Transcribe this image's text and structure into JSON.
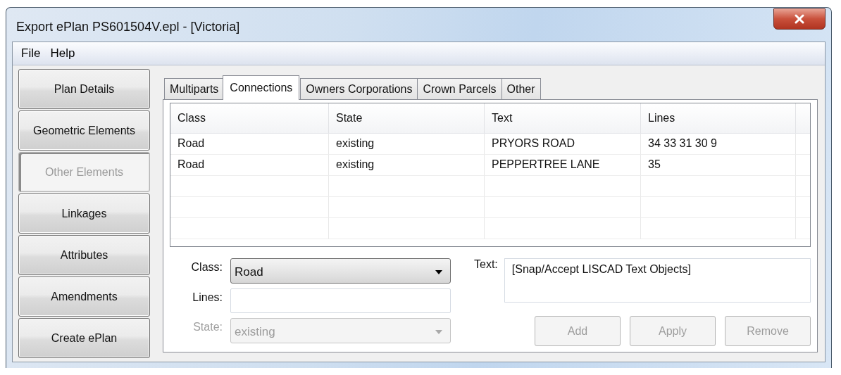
{
  "window": {
    "title": "Export ePlan PS601504V.epl - [Victoria]"
  },
  "menu": [
    {
      "label": "File"
    },
    {
      "label": "Help"
    }
  ],
  "sidebar": {
    "items": [
      {
        "label": "Plan Details",
        "selected": false
      },
      {
        "label": "Geometric Elements",
        "selected": false
      },
      {
        "label": "Other Elements",
        "selected": true
      },
      {
        "label": "Linkages",
        "selected": false
      },
      {
        "label": "Attributes",
        "selected": false
      },
      {
        "label": "Amendments",
        "selected": false
      },
      {
        "label": "Create ePlan",
        "selected": false
      }
    ]
  },
  "tabs": [
    {
      "label": "Multiparts",
      "selected": false
    },
    {
      "label": "Connections",
      "selected": true
    },
    {
      "label": "Owners Corporations",
      "selected": false
    },
    {
      "label": "Crown Parcels",
      "selected": false
    },
    {
      "label": "Other",
      "selected": false
    }
  ],
  "table": {
    "columns": [
      "Class",
      "State",
      "Text",
      "Lines"
    ],
    "rows": [
      [
        "Road",
        "existing",
        "PRYORS ROAD",
        "34 33 31 30 9"
      ],
      [
        "Road",
        "existing",
        "PEPPERTREE LANE",
        "35"
      ]
    ]
  },
  "form": {
    "class": {
      "label": "Class:",
      "value": "Road",
      "disabled": false
    },
    "lines": {
      "label": "Lines:"
    },
    "state": {
      "label": "State:",
      "value": "existing",
      "disabled": true
    },
    "text": {
      "label": "Text:",
      "value": "[Snap/Accept LISCAD Text Objects]"
    }
  },
  "buttons": [
    {
      "label": "Add",
      "disabled": true
    },
    {
      "label": "Apply",
      "disabled": true
    },
    {
      "label": "Remove",
      "disabled": true
    }
  ]
}
